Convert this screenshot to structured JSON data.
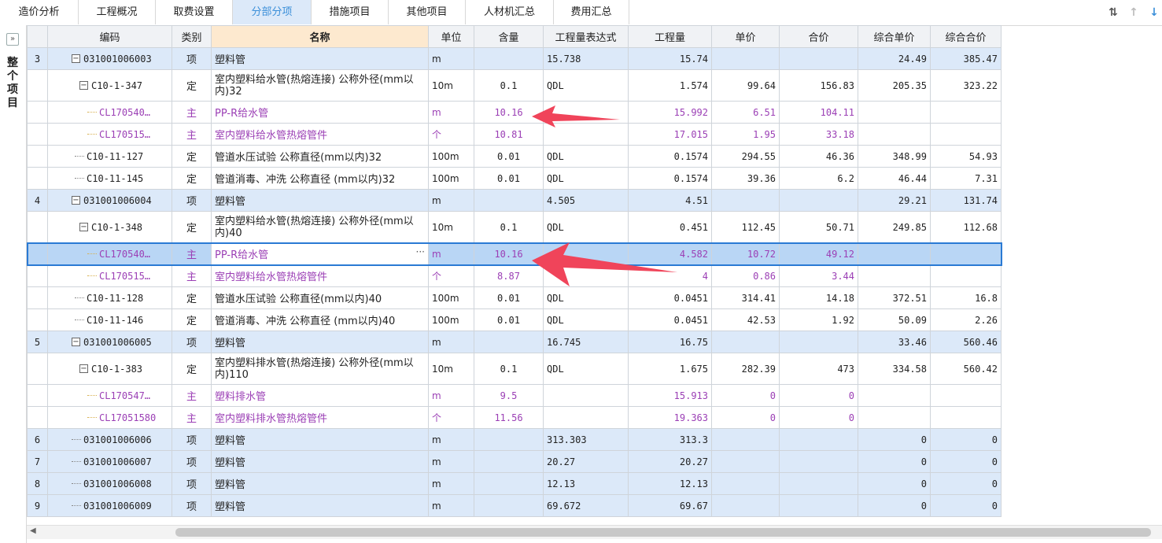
{
  "tabs": [
    "造价分析",
    "工程概况",
    "取费设置",
    "分部分项",
    "措施项目",
    "其他项目",
    "人材机汇总",
    "费用汇总"
  ],
  "active_tab": "分部分项",
  "left_panel": {
    "collapse_icon": "double-chevron-right-icon",
    "label": "整个项目"
  },
  "toolbar_icons": [
    "sort-icon",
    "move-up-icon",
    "move-down-icon"
  ],
  "columns": [
    "",
    "编码",
    "类别",
    "名称",
    "单位",
    "含量",
    "工程量表达式",
    "工程量",
    "单价",
    "合价",
    "综合单价",
    "综合合价"
  ],
  "rows": [
    {
      "idx": "3",
      "code": "031001006003",
      "type": "项",
      "name": "塑料管",
      "unit": "m",
      "content": "",
      "expr": "15.738",
      "qty": "15.74",
      "price": "",
      "total": "",
      "cprice": "24.49",
      "ctotal": "385.47",
      "kind": "item"
    },
    {
      "idx": "",
      "code": "C10-1-347",
      "type": "定",
      "name": "室内塑料给水管(热熔连接) 公称外径(mm以内)32",
      "unit": "10m",
      "content": "0.1",
      "expr": "QDL",
      "qty": "1.574",
      "price": "99.64",
      "total": "156.83",
      "cprice": "205.35",
      "ctotal": "323.22",
      "kind": "quota"
    },
    {
      "idx": "",
      "code": "CL170540…",
      "type": "主",
      "name": "PP-R给水管",
      "unit": "m",
      "content": "10.16",
      "expr": "",
      "qty": "15.992",
      "price": "6.51",
      "total": "104.11",
      "cprice": "",
      "ctotal": "",
      "kind": "sub"
    },
    {
      "idx": "",
      "code": "CL170515…",
      "type": "主",
      "name": "室内塑料给水管热熔管件",
      "unit": "个",
      "content": "10.81",
      "expr": "",
      "qty": "17.015",
      "price": "1.95",
      "total": "33.18",
      "cprice": "",
      "ctotal": "",
      "kind": "sub"
    },
    {
      "idx": "",
      "code": "C10-11-127",
      "type": "定",
      "name": "管道水压试验 公称直径(mm以内)32",
      "unit": "100m",
      "content": "0.01",
      "expr": "QDL",
      "qty": "0.1574",
      "price": "294.55",
      "total": "46.36",
      "cprice": "348.99",
      "ctotal": "54.93",
      "kind": "quota1"
    },
    {
      "idx": "",
      "code": "C10-11-145",
      "type": "定",
      "name": "管道消毒、冲洗 公称直径 (mm以内)32",
      "unit": "100m",
      "content": "0.01",
      "expr": "QDL",
      "qty": "0.1574",
      "price": "39.36",
      "total": "6.2",
      "cprice": "46.44",
      "ctotal": "7.31",
      "kind": "quota1"
    },
    {
      "idx": "4",
      "code": "031001006004",
      "type": "项",
      "name": "塑料管",
      "unit": "m",
      "content": "",
      "expr": "4.505",
      "qty": "4.51",
      "price": "",
      "total": "",
      "cprice": "29.21",
      "ctotal": "131.74",
      "kind": "item"
    },
    {
      "idx": "",
      "code": "C10-1-348",
      "type": "定",
      "name": "室内塑料给水管(热熔连接) 公称外径(mm以内)40",
      "unit": "10m",
      "content": "0.1",
      "expr": "QDL",
      "qty": "0.451",
      "price": "112.45",
      "total": "50.71",
      "cprice": "249.85",
      "ctotal": "112.68",
      "kind": "quota"
    },
    {
      "idx": "",
      "code": "CL170540…",
      "type": "主",
      "name": "PP-R给水管",
      "unit": "m",
      "content": "10.16",
      "expr": "",
      "qty": "4.582",
      "price": "10.72",
      "total": "49.12",
      "cprice": "",
      "ctotal": "",
      "kind": "sel"
    },
    {
      "idx": "",
      "code": "CL170515…",
      "type": "主",
      "name": "室内塑料给水管热熔管件",
      "unit": "个",
      "content": "8.87",
      "expr": "",
      "qty": "4",
      "price": "0.86",
      "total": "3.44",
      "cprice": "",
      "ctotal": "",
      "kind": "sub"
    },
    {
      "idx": "",
      "code": "C10-11-128",
      "type": "定",
      "name": "管道水压试验 公称直径(mm以内)40",
      "unit": "100m",
      "content": "0.01",
      "expr": "QDL",
      "qty": "0.0451",
      "price": "314.41",
      "total": "14.18",
      "cprice": "372.51",
      "ctotal": "16.8",
      "kind": "quota1"
    },
    {
      "idx": "",
      "code": "C10-11-146",
      "type": "定",
      "name": "管道消毒、冲洗 公称直径 (mm以内)40",
      "unit": "100m",
      "content": "0.01",
      "expr": "QDL",
      "qty": "0.0451",
      "price": "42.53",
      "total": "1.92",
      "cprice": "50.09",
      "ctotal": "2.26",
      "kind": "quota1"
    },
    {
      "idx": "5",
      "code": "031001006005",
      "type": "项",
      "name": "塑料管",
      "unit": "m",
      "content": "",
      "expr": "16.745",
      "qty": "16.75",
      "price": "",
      "total": "",
      "cprice": "33.46",
      "ctotal": "560.46",
      "kind": "item"
    },
    {
      "idx": "",
      "code": "C10-1-383",
      "type": "定",
      "name": "室内塑料排水管(热熔连接) 公称外径(mm以内)110",
      "unit": "10m",
      "content": "0.1",
      "expr": "QDL",
      "qty": "1.675",
      "price": "282.39",
      "total": "473",
      "cprice": "334.58",
      "ctotal": "560.42",
      "kind": "quota"
    },
    {
      "idx": "",
      "code": "CL170547…",
      "type": "主",
      "name": "塑料排水管",
      "unit": "m",
      "content": "9.5",
      "expr": "",
      "qty": "15.913",
      "price": "0",
      "total": "0",
      "cprice": "",
      "ctotal": "",
      "kind": "sub"
    },
    {
      "idx": "",
      "code": "CL17051580",
      "type": "主",
      "name": "室内塑料排水管热熔管件",
      "unit": "个",
      "content": "11.56",
      "expr": "",
      "qty": "19.363",
      "price": "0",
      "total": "0",
      "cprice": "",
      "ctotal": "",
      "kind": "sub"
    },
    {
      "idx": "6",
      "code": "031001006006",
      "type": "项",
      "name": "塑料管",
      "unit": "m",
      "content": "",
      "expr": "313.303",
      "qty": "313.3",
      "price": "",
      "total": "",
      "cprice": "0",
      "ctotal": "0",
      "kind": "item0"
    },
    {
      "idx": "7",
      "code": "031001006007",
      "type": "项",
      "name": "塑料管",
      "unit": "m",
      "content": "",
      "expr": "20.27",
      "qty": "20.27",
      "price": "",
      "total": "",
      "cprice": "0",
      "ctotal": "0",
      "kind": "item0"
    },
    {
      "idx": "8",
      "code": "031001006008",
      "type": "项",
      "name": "塑料管",
      "unit": "m",
      "content": "",
      "expr": "12.13",
      "qty": "12.13",
      "price": "",
      "total": "",
      "cprice": "0",
      "ctotal": "0",
      "kind": "item0"
    },
    {
      "idx": "9",
      "code": "031001006009",
      "type": "项",
      "name": "塑料管",
      "unit": "m",
      "content": "",
      "expr": "69.672",
      "qty": "69.67",
      "price": "",
      "total": "",
      "cprice": "0",
      "ctotal": "0",
      "kind": "item0"
    }
  ],
  "colors": {
    "accent": "#3b8fd9",
    "item_row": "#dce9f9",
    "sub_text": "#9b3fb5",
    "arrow": "#f0445a",
    "selected_row": "#b9d6f5"
  }
}
